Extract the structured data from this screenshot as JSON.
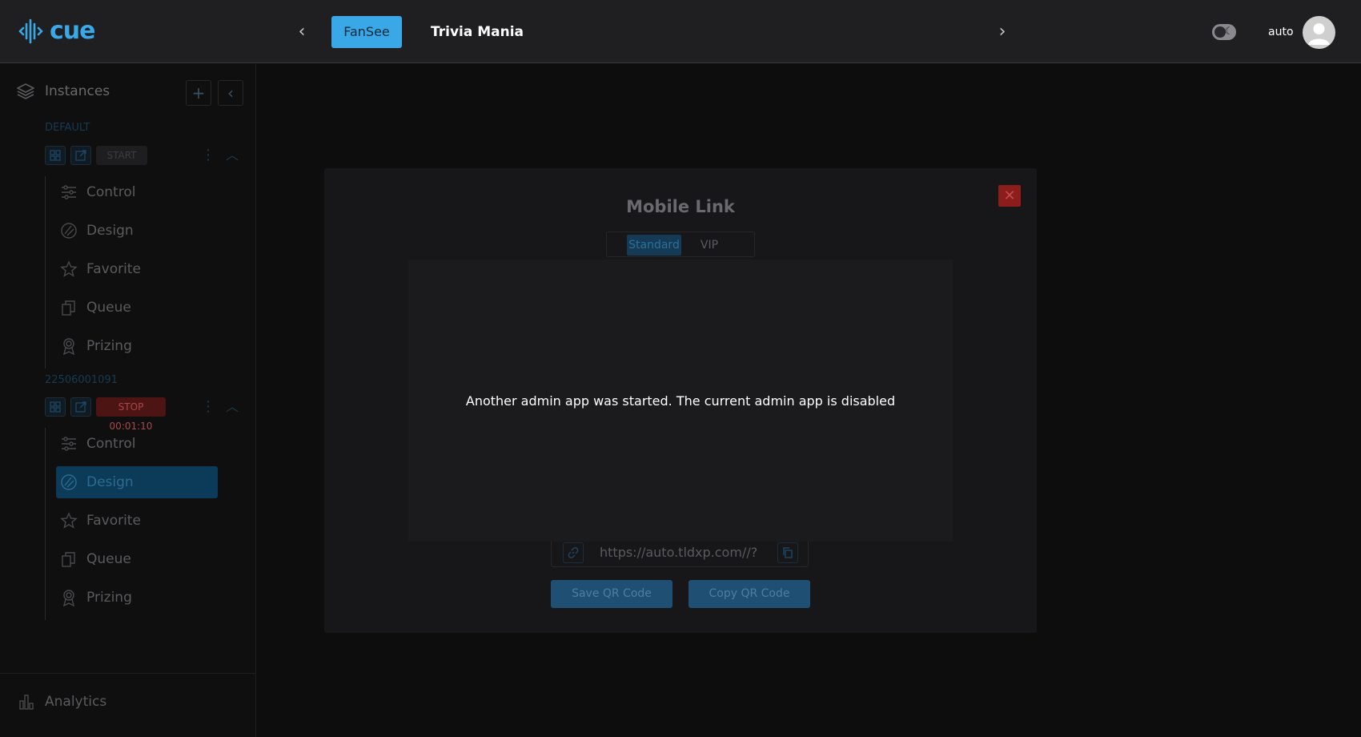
{
  "header": {
    "logo_text": "cue",
    "tabs": [
      {
        "label": "FanSee"
      },
      {
        "label": "Trivia Mania"
      }
    ],
    "user_name": "auto"
  },
  "sidebar": {
    "title": "Instances",
    "groups": [
      {
        "name": "DEFAULT",
        "action_label": "START",
        "items": [
          "Control",
          "Design",
          "Favorite",
          "Queue",
          "Prizing"
        ]
      },
      {
        "name": "22506001091",
        "action_label": "STOP 00:01:10",
        "items": [
          "Control",
          "Design",
          "Favorite",
          "Queue",
          "Prizing"
        ],
        "active_item": "Design"
      }
    ],
    "analytics_label": "Analytics"
  },
  "modal": {
    "title": "Mobile Link",
    "segments": [
      "Standard",
      "VIP"
    ],
    "selected_segment": "Standard",
    "link_text": "https://auto.tldxp.com//?",
    "save_button": "Save QR Code",
    "copy_button": "Copy QR Code"
  },
  "alert": {
    "message": "Another admin app was started. The current admin app is disabled"
  },
  "colors": {
    "accent": "#3aa7e6",
    "header_bg": "#1f1f21",
    "close_red": "#8b1d1d",
    "stop_red": "#4d1414"
  }
}
